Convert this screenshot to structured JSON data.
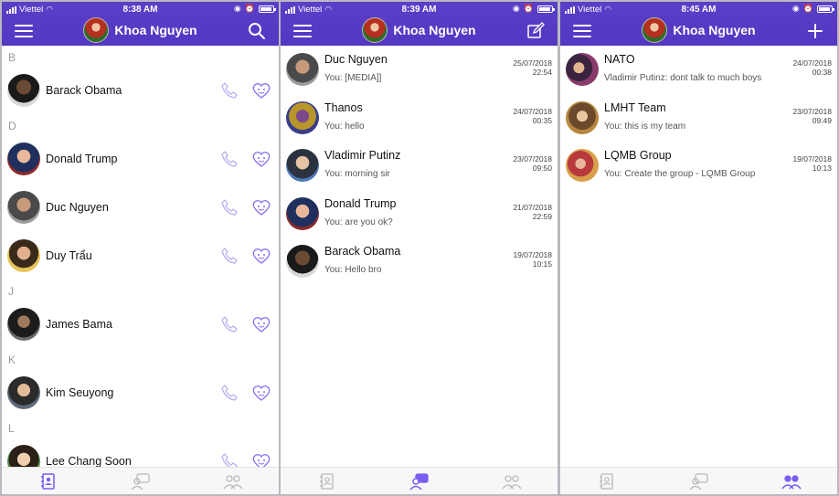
{
  "colors": {
    "header": "#5437c2",
    "accent": "#7a5cf0",
    "icon_inactive": "#b9b9b9"
  },
  "screens": [
    {
      "status": {
        "carrier": "Viettel",
        "time": "8:38 AM"
      },
      "header": {
        "title": "Khoa Nguyen",
        "action_icon": "search-icon"
      },
      "sections": [
        {
          "letter": "B",
          "contacts": [
            {
              "name": "Barack Obama"
            }
          ]
        },
        {
          "letter": "D",
          "contacts": [
            {
              "name": "Donald Trump"
            },
            {
              "name": "Duc Nguyen"
            },
            {
              "name": "Duy Trẩu"
            }
          ]
        },
        {
          "letter": "J",
          "contacts": [
            {
              "name": "James Bama"
            }
          ]
        },
        {
          "letter": "K",
          "contacts": [
            {
              "name": "Kim Seuyong"
            }
          ]
        },
        {
          "letter": "L",
          "contacts": [
            {
              "name": "Lee Chang Soon"
            }
          ]
        }
      ],
      "active_tab": 0
    },
    {
      "status": {
        "carrier": "Viettel",
        "time": "8:39 AM"
      },
      "header": {
        "title": "Khoa Nguyen",
        "action_icon": "compose-icon"
      },
      "conversations": [
        {
          "name": "Duc Nguyen",
          "preview": "You: [MEDIA]]",
          "date": "25/07/2018",
          "time": "22:54"
        },
        {
          "name": "Thanos",
          "preview": "You: hello",
          "date": "24/07/2018",
          "time": "00:35"
        },
        {
          "name": "Vladimir Putinz",
          "preview": "You: morning sir",
          "date": "23/07/2018",
          "time": "09:50"
        },
        {
          "name": "Donald Trump",
          "preview": "You: are you ok?",
          "date": "21/07/2018",
          "time": "22:59"
        },
        {
          "name": "Barack Obama",
          "preview": "You: Hello bro",
          "date": "19/07/2018",
          "time": "10:15"
        }
      ],
      "active_tab": 1
    },
    {
      "status": {
        "carrier": "Viettel",
        "time": "8:45 AM"
      },
      "header": {
        "title": "Khoa Nguyen",
        "action_icon": "plus-icon"
      },
      "conversations": [
        {
          "name": "NATO",
          "preview": "Vladimir Putinz: dont talk to much boys",
          "date": "24/07/2018",
          "time": "00:38"
        },
        {
          "name": "LMHT Team",
          "preview": "You: this is my team",
          "date": "23/07/2018",
          "time": "09:49"
        },
        {
          "name": "LQMB Group",
          "preview": "You: Create the group - LQMB Group",
          "date": "19/07/2018",
          "time": "10:13"
        }
      ],
      "active_tab": 2
    }
  ]
}
